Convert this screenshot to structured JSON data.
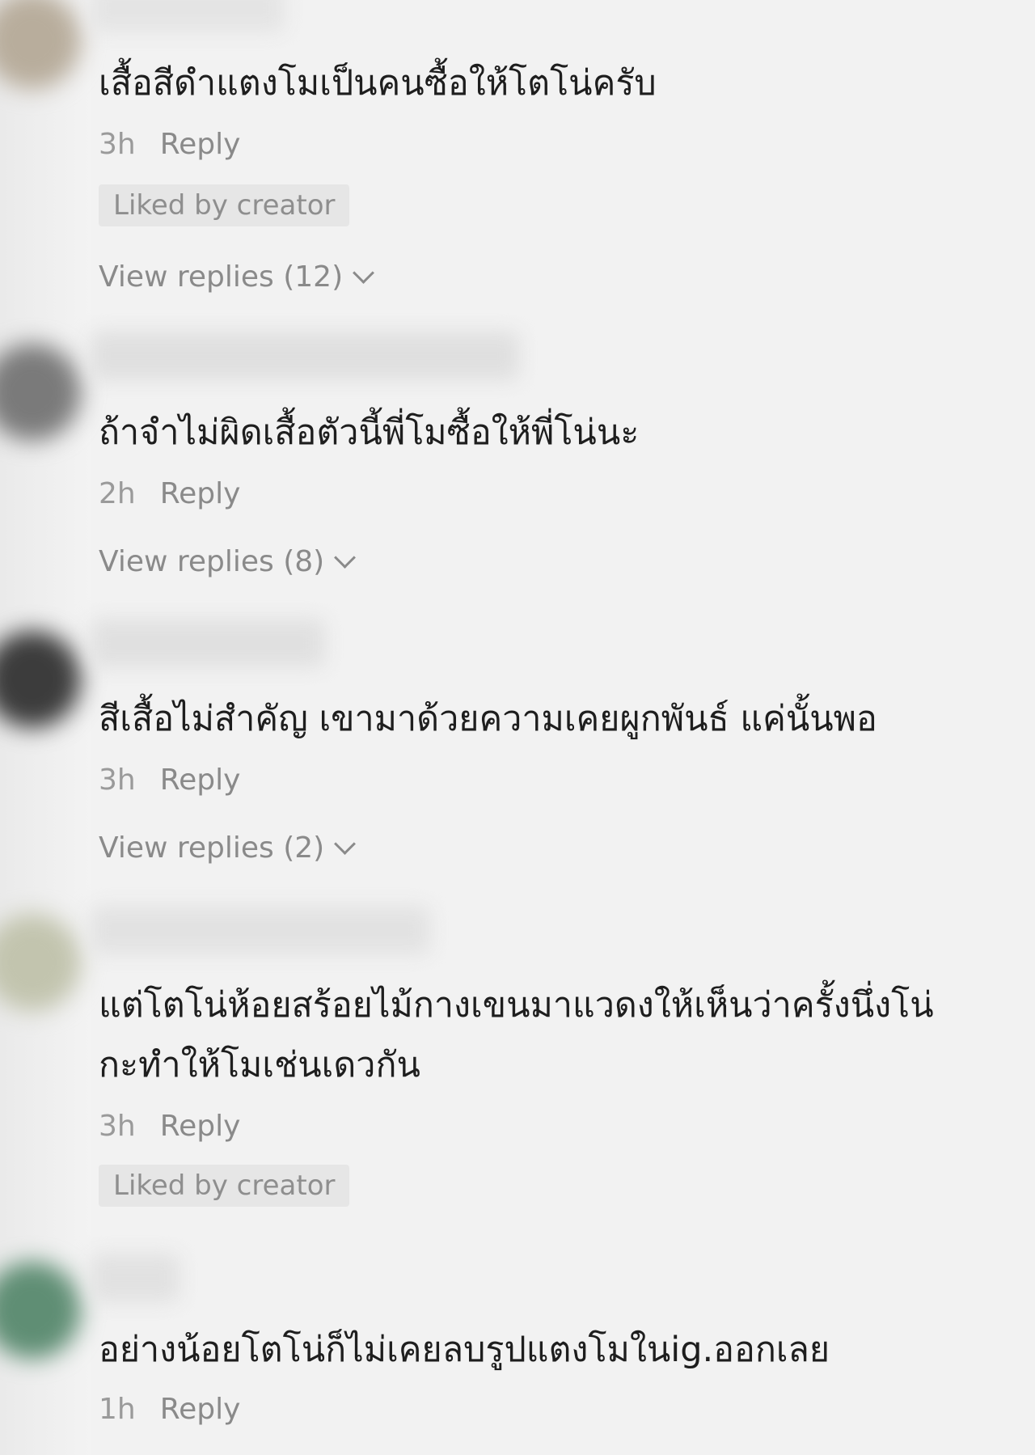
{
  "comments": [
    {
      "text": "เสื้อสีดำแตงโมเป็นคนซื้อให้โตโน่ครับ",
      "time": "3h",
      "reply_label": "Reply",
      "liked_by_creator": "Liked by creator",
      "view_replies": "View replies (12)",
      "avatar_color": "#b8ad9c"
    },
    {
      "text": "ถ้าจำไม่ผิดเสื้อตัวนี้พี่โมซื้อให้พี่โน่นะ",
      "time": "2h",
      "reply_label": "Reply",
      "view_replies": "View replies (8)",
      "avatar_color": "#7a7a7a"
    },
    {
      "text": "สีเสื้อไม่สำคัญ เขามาด้วยความเคยผูกพันธ์ แค่นั้นพอ",
      "time": "3h",
      "reply_label": "Reply",
      "view_replies": "View replies (2)",
      "avatar_color": "#3c3c3c"
    },
    {
      "text": "แต่โตโน่ห้อยสร้อยไม้กางเขนมาแวดงให้เห็นว่าครั้งนึ่งโน่กะทำให้โมเช่นเดวกัน",
      "time": "3h",
      "reply_label": "Reply",
      "liked_by_creator": "Liked by creator",
      "avatar_color": "#c2c4ae"
    },
    {
      "text": "อย่างน้อยโตโน่ก็ไม่เคยลบรูปแตงโมในig.ออกเลย",
      "time": "1h",
      "reply_label": "Reply",
      "avatar_color": "#5f8e74"
    }
  ]
}
